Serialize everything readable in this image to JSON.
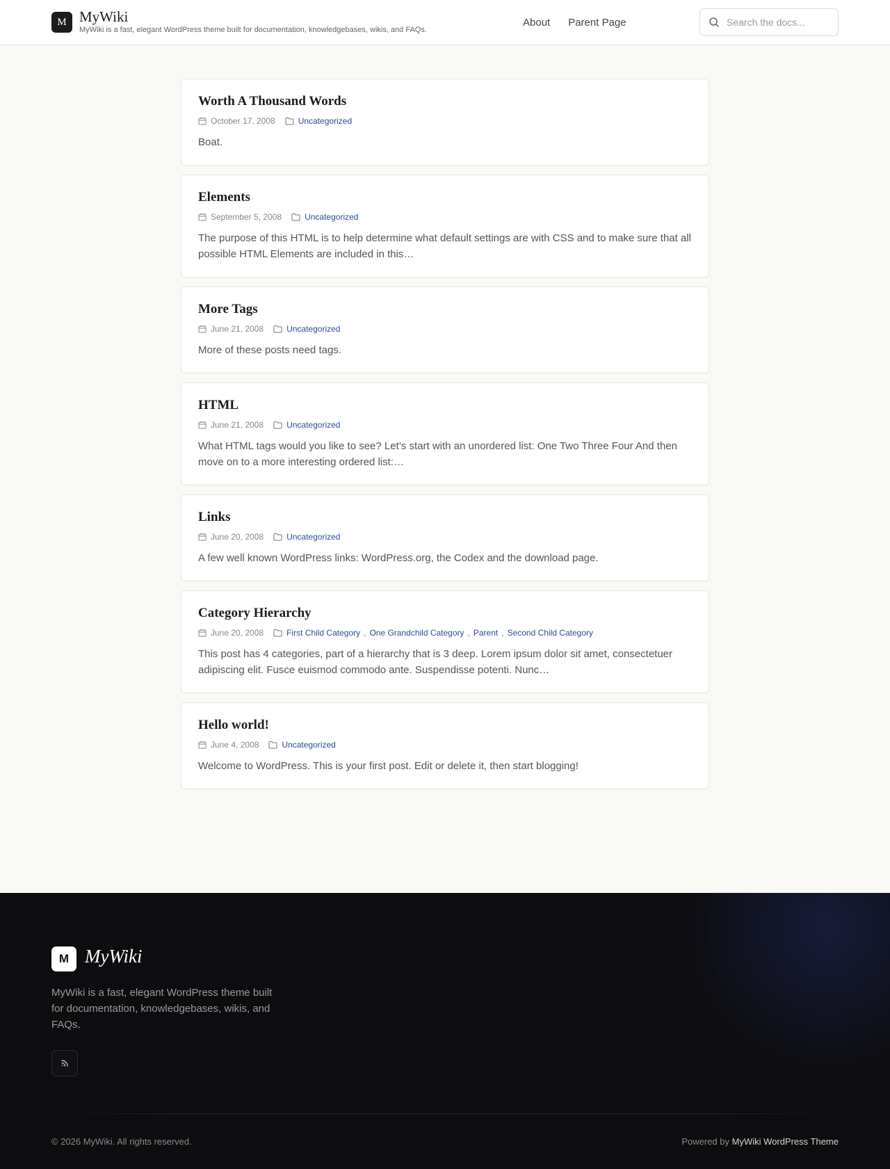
{
  "header": {
    "logo_letter": "M",
    "site_title": "MyWiki",
    "tagline": "MyWiki is a fast, elegant WordPress theme built for documentation, knowledgebases, wikis, and FAQs.",
    "nav": [
      {
        "label": "About"
      },
      {
        "label": "Parent Page"
      }
    ],
    "search_placeholder": "Search the docs..."
  },
  "posts": [
    {
      "title": "Worth A Thousand Words",
      "date": "October 17, 2008",
      "categories": [
        "Uncategorized"
      ],
      "excerpt": "Boat."
    },
    {
      "title": "Elements",
      "date": "September 5, 2008",
      "categories": [
        "Uncategorized"
      ],
      "excerpt": "The purpose of this HTML is to help determine what default settings are with CSS and to make sure that all possible HTML Elements are included in this…"
    },
    {
      "title": "More Tags",
      "date": "June 21, 2008",
      "categories": [
        "Uncategorized"
      ],
      "excerpt": "More of these posts need tags."
    },
    {
      "title": "HTML",
      "date": "June 21, 2008",
      "categories": [
        "Uncategorized"
      ],
      "excerpt": "What HTML tags would you like to see? Let’s start with an unordered list: One Two Three Four And then move on to a more interesting ordered list:…"
    },
    {
      "title": "Links",
      "date": "June 20, 2008",
      "categories": [
        "Uncategorized"
      ],
      "excerpt": "A few well known WordPress links: WordPress.org, the Codex and the download page."
    },
    {
      "title": "Category Hierarchy",
      "date": "June 20, 2008",
      "categories": [
        "First Child Category",
        "One Grandchild Category",
        "Parent",
        "Second Child Category"
      ],
      "excerpt": "This post has 4 categories, part of a hierarchy that is 3 deep. Lorem ipsum dolor sit amet, consectetuer adipiscing elit. Fusce euismod commodo ante. Suspendisse potenti. Nunc…"
    },
    {
      "title": "Hello world!",
      "date": "June 4, 2008",
      "categories": [
        "Uncategorized"
      ],
      "excerpt": "Welcome to WordPress. This is your first post. Edit or delete it, then start blogging!"
    }
  ],
  "footer": {
    "logo_letter": "M",
    "site_title": "MyWiki",
    "description": "MyWiki is a fast, elegant WordPress theme built for documentation, knowledgebases, wikis, and FAQs.",
    "rss_icon": "rss-icon",
    "copyright": "© 2026 MyWiki. All rights reserved.",
    "powered_prefix": "Powered by ",
    "powered_link": "MyWiki WordPress Theme"
  },
  "icons": {
    "search": "search-icon",
    "date": "calendar-icon",
    "category": "folder-icon"
  },
  "colors": {
    "accent_link": "#2b4f8f",
    "footer_bg": "#0d0d10",
    "page_bg": "#f9f9f7"
  }
}
